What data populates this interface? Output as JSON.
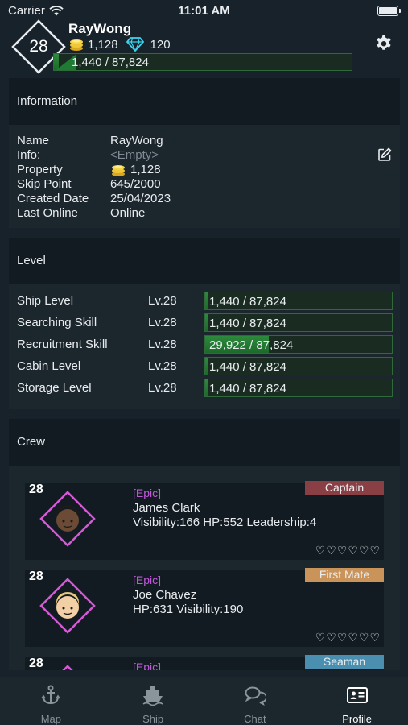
{
  "status_bar": {
    "carrier": "Carrier",
    "time": "11:01 AM"
  },
  "profile": {
    "level": "28",
    "username": "RayWong",
    "coins": "1,128",
    "gems": "120",
    "xp_text": "1,440 / 87,824",
    "xp_progress": 0.016
  },
  "information": {
    "title": "Information",
    "rows": [
      {
        "key": "Name",
        "value": "RayWong"
      },
      {
        "key": "Info:",
        "value": "<Empty>"
      },
      {
        "key": "Property",
        "value": "1,128"
      },
      {
        "key": "Skip Point",
        "value": "645/2000"
      },
      {
        "key": "Created Date",
        "value": "25/04/2023"
      },
      {
        "key": "Last Online",
        "value": "Online"
      }
    ]
  },
  "level_section": {
    "title": "Level",
    "rows": [
      {
        "name": "Ship Level",
        "lv": "Lv.28",
        "text": "1,440 / 87,824",
        "progress": 0.016
      },
      {
        "name": "Searching Skill",
        "lv": "Lv.28",
        "text": "1,440 / 87,824",
        "progress": 0.016
      },
      {
        "name": "Recruitment Skill",
        "lv": "Lv.28",
        "text": "29,922 / 87,824",
        "progress": 0.34
      },
      {
        "name": "Cabin Level",
        "lv": "Lv.28",
        "text": "1,440 / 87,824",
        "progress": 0.016
      },
      {
        "name": "Storage Level",
        "lv": "Lv.28",
        "text": "1,440 / 87,824",
        "progress": 0.016
      }
    ]
  },
  "crew": {
    "title": "Crew",
    "members": [
      {
        "level": "28",
        "rarity": "[Epic]",
        "name": "James Clark",
        "stats": "Visibility:166  HP:552  Leadership:4",
        "rank": "Captain",
        "rank_color": "#8a3f45",
        "hearts": "♡♡♡♡♡♡",
        "skin": "#6b4a36",
        "hair": "#1f1a17"
      },
      {
        "level": "28",
        "rarity": "[Epic]",
        "name": "Joe Chavez",
        "stats": "HP:631  Visibility:190",
        "rank": "First Mate",
        "rank_color": "#c9935a",
        "hearts": "♡♡♡♡♡♡",
        "skin": "#f3cfa6",
        "hair": "#e9c77c"
      },
      {
        "level": "28",
        "rarity": "[Epic]",
        "name": "",
        "stats": "",
        "rank": "Seaman",
        "rank_color": "#4a8fb0",
        "hearts": "",
        "skin": "#f3cfa6",
        "hair": "#5a3a22"
      }
    ]
  },
  "tabs": [
    {
      "label": "Map",
      "icon": "anchor-icon"
    },
    {
      "label": "Ship",
      "icon": "ship-icon"
    },
    {
      "label": "Chat",
      "icon": "chat-bubbles-icon"
    },
    {
      "label": "Profile",
      "icon": "id-card-icon",
      "active": true
    }
  ],
  "colors": {
    "accent_green": "#2c8a3c",
    "epic_purple": "#c05ad9",
    "diamond_border": "#e8ecef"
  }
}
